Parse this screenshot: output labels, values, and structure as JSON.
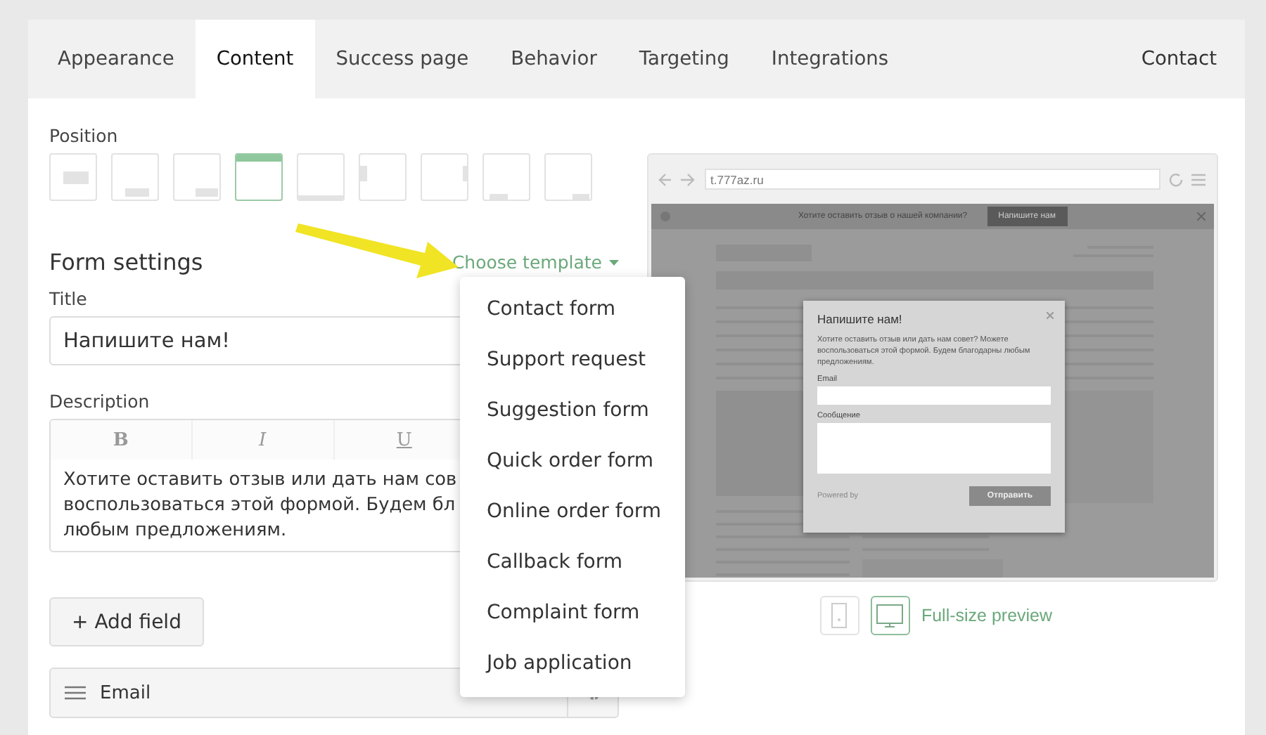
{
  "tabs": [
    {
      "label": "Appearance",
      "selected": false
    },
    {
      "label": "Content",
      "selected": true
    },
    {
      "label": "Success page",
      "selected": false
    },
    {
      "label": "Behavior",
      "selected": false
    },
    {
      "label": "Targeting",
      "selected": false
    },
    {
      "label": "Integrations",
      "selected": false
    }
  ],
  "contact_link": "Contact",
  "position": {
    "label": "Position",
    "options": [
      {
        "kind": "center",
        "selected": false
      },
      {
        "kind": "bottom-center",
        "selected": false
      },
      {
        "kind": "bottom-right",
        "selected": false
      },
      {
        "kind": "top-bar",
        "selected": true
      },
      {
        "kind": "bottom-bar",
        "selected": false
      },
      {
        "kind": "left-middle",
        "selected": false
      },
      {
        "kind": "right-middle",
        "selected": false
      },
      {
        "kind": "bottom-left",
        "selected": false
      },
      {
        "kind": "bottom-right-small",
        "selected": false
      }
    ]
  },
  "form_settings": {
    "heading": "Form settings",
    "template_button": "Choose template"
  },
  "template_menu": [
    "Contact form",
    "Support request",
    "Suggestion form",
    "Quick order form",
    "Online order form",
    "Callback form",
    "Complaint form",
    "Job application"
  ],
  "title_field": {
    "label": "Title",
    "value": "Напишите нам!"
  },
  "description": {
    "label": "Description",
    "toolbar": [
      "B",
      "I",
      "U"
    ],
    "lines": [
      "Хотите оставить отзыв или дать нам сов",
      "воспользоваться этой формой. Будем бл",
      "любым предложениям."
    ]
  },
  "add_field_button": "+ Add field",
  "fields": [
    {
      "label": "Email"
    }
  ],
  "preview": {
    "url": "t.777az.ru",
    "banner_text": "Хотите оставить отзыв о нашей компании?",
    "banner_button": "Напишите нам",
    "popup": {
      "title": "Напишите нам!",
      "text": "Хотите оставить отзыв или дать нам совет? Можете воспользоваться этой формой. Будем благодарны любым предложениям.",
      "fields": [
        {
          "label": "Email",
          "kind": "input"
        },
        {
          "label": "Сообщение",
          "kind": "textarea"
        }
      ],
      "powered_by": "Powered by",
      "submit": "Отправить"
    }
  },
  "preview_modes": [
    {
      "kind": "mobile",
      "selected": false
    },
    {
      "kind": "desktop",
      "selected": true
    }
  ],
  "full_size_link": "Full-size preview"
}
